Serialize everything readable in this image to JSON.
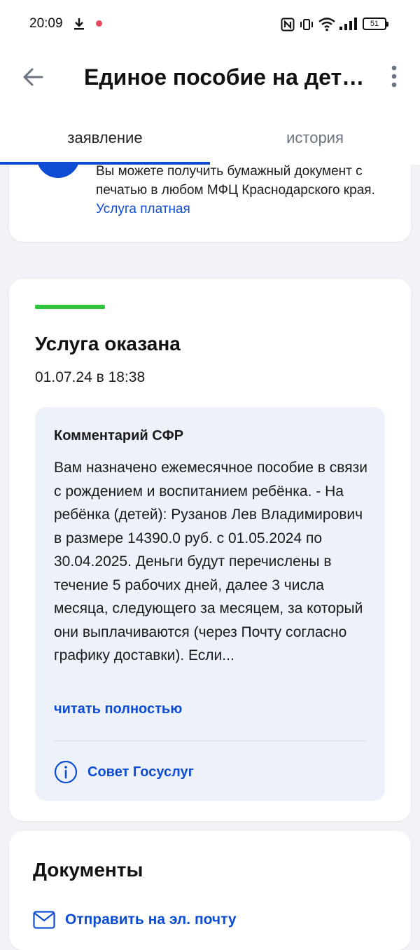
{
  "status_bar": {
    "time": "20:09",
    "battery": "51",
    "icons": [
      "download-icon",
      "record-dot-icon",
      "nfc-icon",
      "vibrate-icon",
      "wifi-icon",
      "signal-icon",
      "battery-icon"
    ]
  },
  "app_bar": {
    "title": "Единое пособие на дет…",
    "back_icon": "arrow-left-icon",
    "menu_icon": "more-vertical-icon"
  },
  "tabs": [
    {
      "label": "заявление",
      "active": true
    },
    {
      "label": "история",
      "active": false
    }
  ],
  "info_card": {
    "text": "Вы можете получить бумажный документ с печатью в любом МФЦ Краснодарского края. ",
    "link": "Услуга платная"
  },
  "status_card": {
    "accent_color": "#2bc43a",
    "status": "Услуга оказана",
    "date": "01.07.24 в 18:38",
    "comment": {
      "title": "Комментарий СФР",
      "text": "Вам назначено ежемесячное пособие в связи с рождением и воспитанием ребёнка. - На ребёнка (детей): Рузанов Лев Владимирович в размере 14390.0 руб. с 01.05.2024 по 30.04.2025. Деньги будут перечислены в течение 5 рабочих дней, далее 3 числа месяца, следующего за месяцем, за который они выплачиваются (через Почту согласно графику доставки). Если...",
      "read_more": "читать полностью",
      "advice": "Совет Госуслуг",
      "advice_icon": "info-circle-icon"
    }
  },
  "documents_card": {
    "title": "Документы",
    "email_action": "Отправить на эл. почту",
    "email_icon": "envelope-icon"
  },
  "colors": {
    "primary": "#0d4cd3",
    "background": "#f1f3f6",
    "comment_bg": "#edf2fa",
    "success": "#2bc43a"
  }
}
